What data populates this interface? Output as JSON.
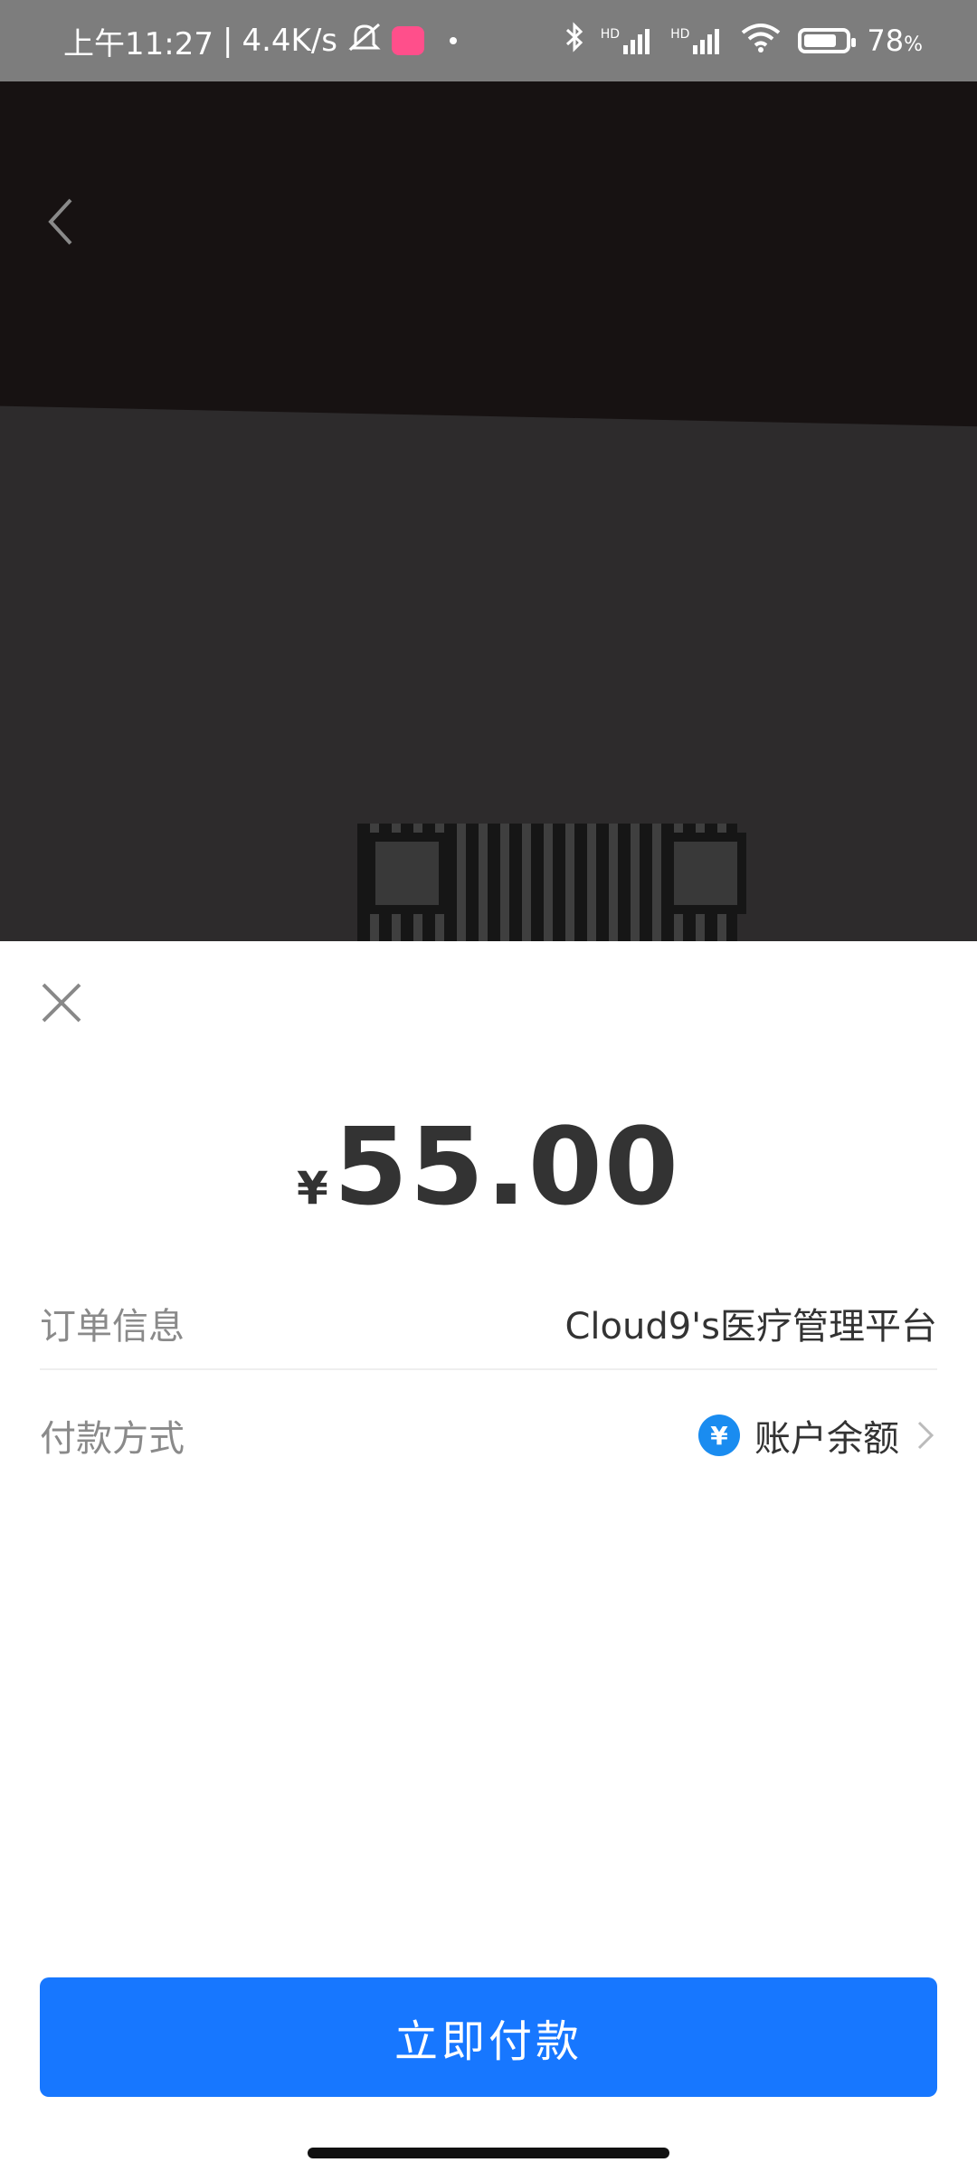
{
  "status_bar": {
    "time": "上午11:27",
    "separator": "|",
    "net_speed": "4.4K/s",
    "battery": "78",
    "battery_unit": "%",
    "signal_label_1": "HD",
    "signal_label_2": "HD",
    "icons": [
      "mute-icon",
      "app-badge-icon",
      "bluetooth-icon",
      "signal-icon",
      "wifi-icon",
      "battery-icon"
    ]
  },
  "camera": {
    "back_icon": "chevron-left-icon"
  },
  "sheet": {
    "close_icon": "close-icon",
    "currency_symbol": "¥",
    "amount": "55.00",
    "order_label": "订单信息",
    "order_value": "Cloud9's医疗管理平台",
    "payment_label": "付款方式",
    "payment_icon_symbol": "¥",
    "payment_value": "账户余额",
    "pay_button": "立即付款"
  },
  "colors": {
    "accent": "#1777ff",
    "yen_icon": "#1a8cf0",
    "label_gray": "#8a8a8a",
    "value_dark": "#333333"
  }
}
